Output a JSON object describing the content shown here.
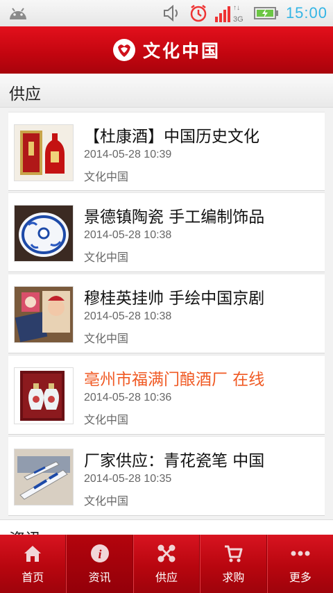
{
  "status_bar": {
    "time": "15:00",
    "network": "3G",
    "icons": [
      "android-icon",
      "volume-icon",
      "alarm-icon",
      "signal-icon",
      "battery-icon"
    ]
  },
  "header": {
    "logo_text": "文化中国"
  },
  "section": {
    "title": "供应"
  },
  "items": [
    {
      "title": "【杜康酒】中国历史文化",
      "date": "2014-05-28 10:39",
      "source": "文化中国",
      "highlight": false
    },
    {
      "title": "景德镇陶瓷 手工编制饰品",
      "date": "2014-05-28 10:38",
      "source": "文化中国",
      "highlight": false
    },
    {
      "title": "穆桂英挂帅 手绘中国京剧",
      "date": "2014-05-28 10:38",
      "source": "文化中国",
      "highlight": false
    },
    {
      "title": "亳州市福满门酿酒厂 在线",
      "date": "2014-05-28 10:36",
      "source": "文化中国",
      "highlight": true
    },
    {
      "title": "厂家供应：青花瓷笔 中国",
      "date": "2014-05-28 10:35",
      "source": "文化中国",
      "highlight": false
    }
  ],
  "section2": {
    "title": "资讯"
  },
  "tabs": [
    {
      "label": "首页",
      "icon": "home-icon"
    },
    {
      "label": "资讯",
      "icon": "info-icon"
    },
    {
      "label": "供应",
      "icon": "supply-icon"
    },
    {
      "label": "求购",
      "icon": "cart-icon"
    },
    {
      "label": "更多",
      "icon": "more-icon"
    }
  ],
  "colors": {
    "brand_red": "#c2050f",
    "highlight_orange": "#f05a24",
    "clock_blue": "#33b5e5"
  }
}
